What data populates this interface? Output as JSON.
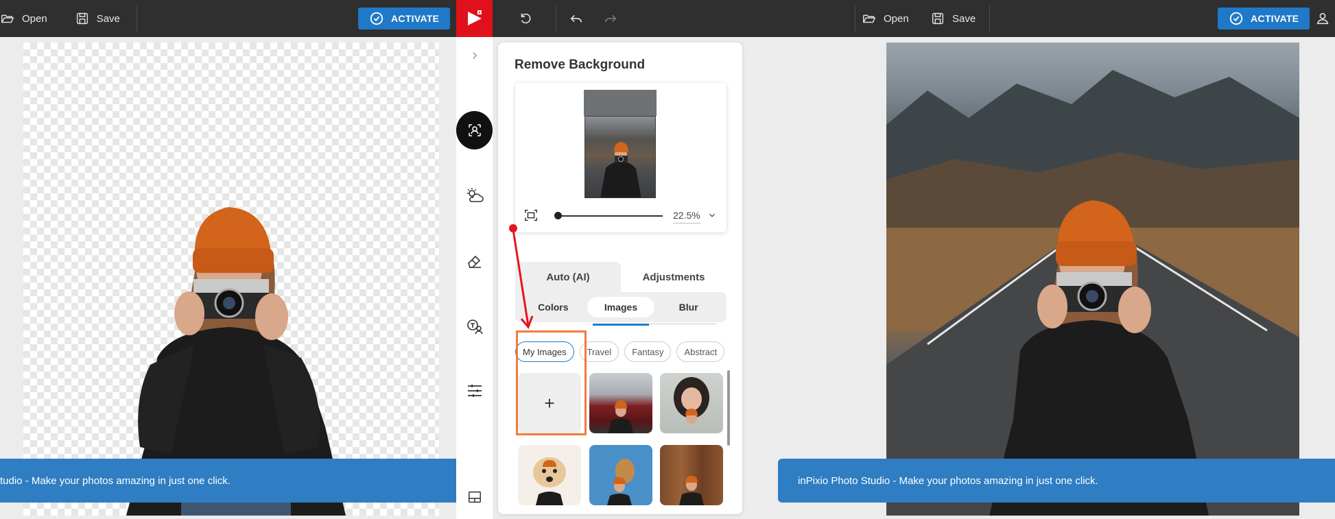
{
  "left_toolbar": {
    "open_label": "Open",
    "save_label": "Save",
    "activate_label": "ACTIVATE"
  },
  "right_toolbar": {
    "open_label": "Open",
    "save_label": "Save",
    "activate_label": "ACTIVATE"
  },
  "panel": {
    "title": "Remove Background",
    "zoom_value": "22.5%",
    "tabs": [
      {
        "label": "Auto (AI)",
        "active": true
      },
      {
        "label": "Adjustments",
        "active": false
      }
    ],
    "subtabs": [
      {
        "label": "Colors",
        "active": false
      },
      {
        "label": "Images",
        "active": true
      },
      {
        "label": "Blur",
        "active": false
      }
    ],
    "chips": [
      {
        "label": "My Images",
        "active": true
      },
      {
        "label": "Travel",
        "active": false
      },
      {
        "label": "Fantasy",
        "active": false
      },
      {
        "label": "Abstract",
        "active": false
      }
    ],
    "add_label": "+"
  },
  "banner_left_text": "tudio - Make your photos amazing in just one click.",
  "banner_right_text": "inPixio Photo Studio - Make your photos amazing in just one click.",
  "colors": {
    "activate": "#1f79c8",
    "brand_red": "#e1111c",
    "topbar": "#2f2f2f",
    "highlight_orange": "#f07b3c",
    "annotation_red": "#e8141c"
  }
}
